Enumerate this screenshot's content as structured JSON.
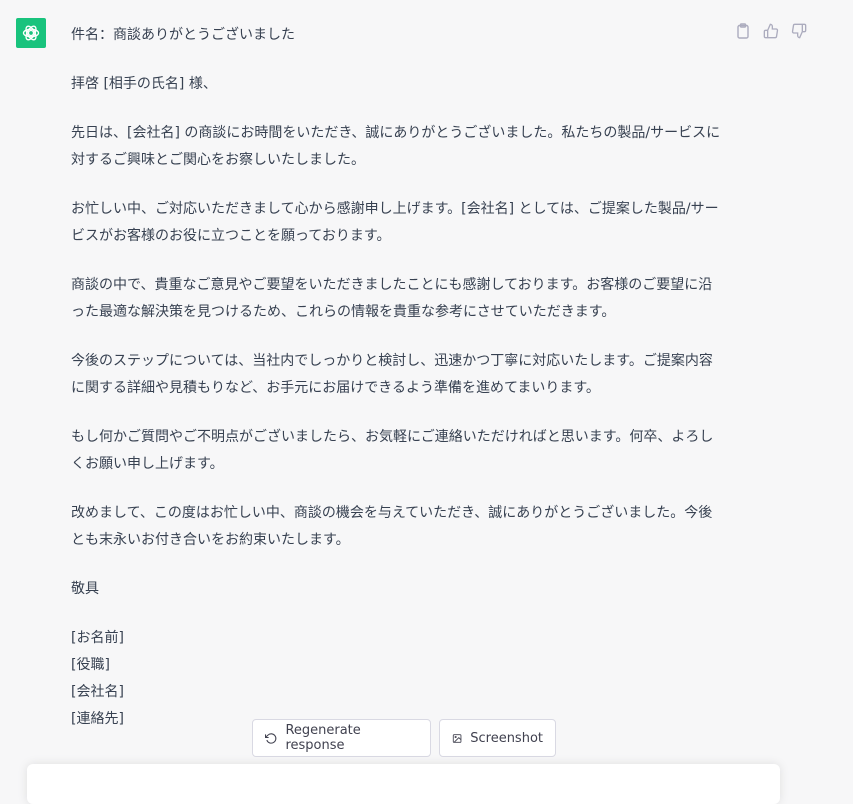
{
  "accent_color": "#19c37d",
  "message": {
    "avatar_icon": "openai-logo-icon",
    "paragraphs": [
      "件名：商談ありがとうございました",
      "拝啓 [相手の氏名] 様、",
      "先日は、[会社名] の商談にお時間をいただき、誠にありがとうございました。私たちの製品/サービスに対するご興味とご関心をお察しいたしました。",
      "お忙しい中、ご対応いただきまして心から感謝申し上げます。[会社名] としては、ご提案した製品/サービスがお客様のお役に立つことを願っております。",
      "商談の中で、貴重なご意見やご要望をいただきましたことにも感謝しております。お客様のご要望に沿った最適な解決策を見つけるため、これらの情報を貴重な参考にさせていただきます。",
      "今後のステップについては、当社内でしっかりと検討し、迅速かつ丁寧に対応いたします。ご提案内容に関する詳細や見積もりなど、お手元にお届けできるよう準備を進めてまいります。",
      "もし何かご質問やご不明点がございましたら、お気軽にご連絡いただければと思います。何卒、よろしくお願い申し上げます。",
      "改めまして、この度はお忙しい中、商談の機会を与えていただき、誠にありがとうございました。今後とも末永いお付き合いをお約束いたします。",
      "敬具"
    ],
    "signature": [
      "[お名前]",
      "[役職]",
      "[会社名]",
      "[連絡先]"
    ]
  },
  "actions": {
    "copy_icon": "clipboard-icon",
    "like_icon": "thumbs-up-icon",
    "dislike_icon": "thumbs-down-icon"
  },
  "buttons": {
    "regenerate": "Regenerate response",
    "screenshot": "Screenshot"
  }
}
